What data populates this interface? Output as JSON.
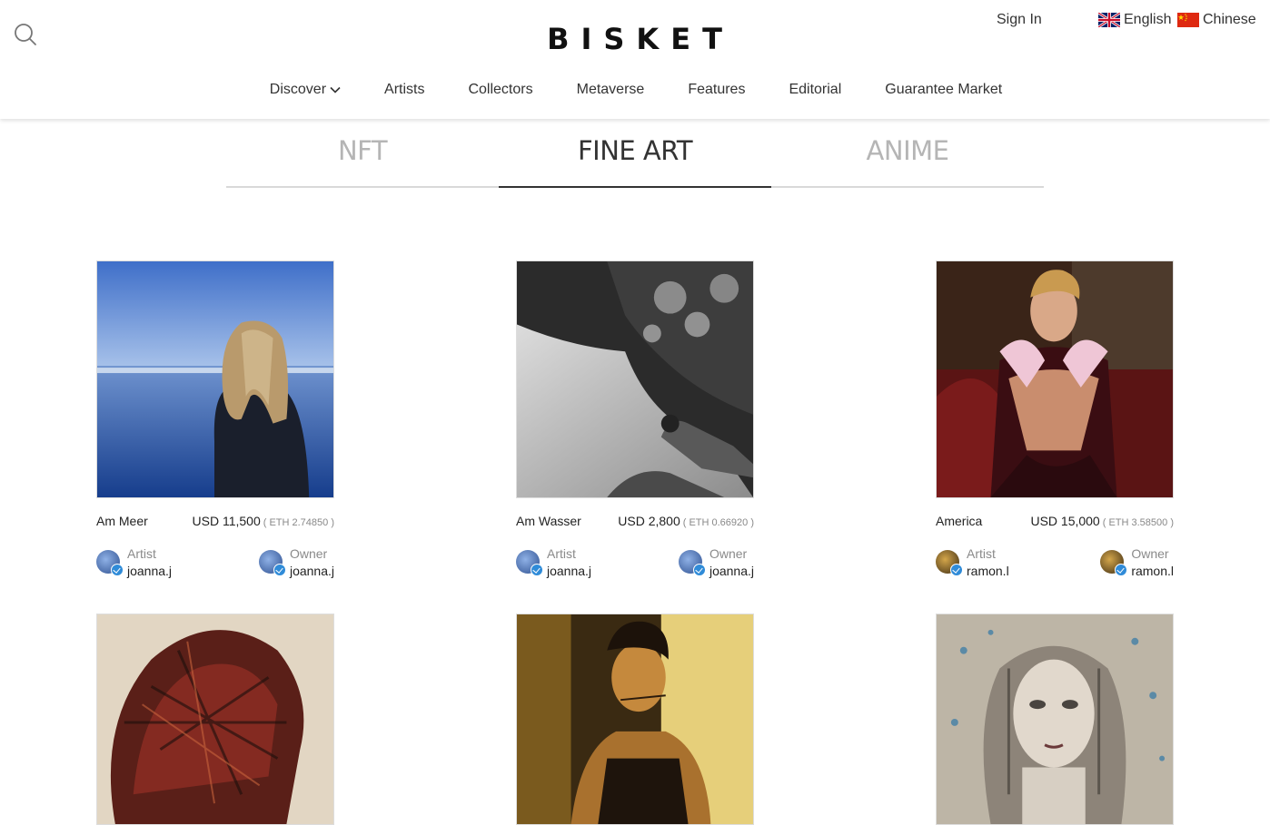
{
  "header": {
    "logo": "BISKET",
    "sign_in": "Sign In",
    "languages": [
      {
        "label": "English",
        "flag": "uk-flag-icon"
      },
      {
        "label": "Chinese",
        "flag": "china-flag-icon"
      }
    ]
  },
  "nav": {
    "items": [
      {
        "label": "Discover",
        "has_dropdown": true
      },
      {
        "label": "Artists"
      },
      {
        "label": "Collectors"
      },
      {
        "label": "Metaverse"
      },
      {
        "label": "Features"
      },
      {
        "label": "Editorial"
      },
      {
        "label": "Guarantee Market"
      }
    ]
  },
  "tabs": [
    {
      "label": "NFT",
      "active": false
    },
    {
      "label": "FINE ART",
      "active": true
    },
    {
      "label": "ANIME",
      "active": false
    }
  ],
  "artworks": [
    {
      "title": "Am Meer",
      "price": "USD 11,500",
      "eth": "( ETH 2.74850 )",
      "artist_role": "Artist",
      "artist": "joanna.j",
      "owner_role": "Owner",
      "owner": "joanna.j"
    },
    {
      "title": "Am Wasser",
      "price": "USD 2,800",
      "eth": "( ETH 0.66920 )",
      "artist_role": "Artist",
      "artist": "joanna.j",
      "owner_role": "Owner",
      "owner": "joanna.j"
    },
    {
      "title": "America",
      "price": "USD 15,000",
      "eth": "( ETH 3.58500 )",
      "artist_role": "Artist",
      "artist": "ramon.l",
      "owner_role": "Owner",
      "owner": "ramon.l"
    }
  ],
  "colors": {
    "accent_text": "#333333",
    "inactive_tab": "#b5b5b5",
    "verified_badge": "#2f8bd8"
  }
}
